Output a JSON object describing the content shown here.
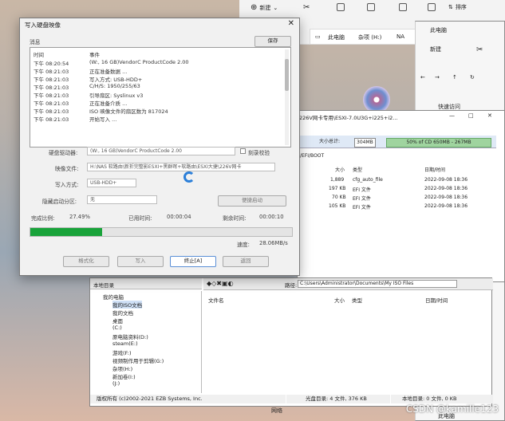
{
  "explorer": {
    "new_label": "新建",
    "sort_label": "排序",
    "path": [
      "此电脑",
      "杂项 (H:)",
      "NA"
    ],
    "second_window_title": "此电脑",
    "second_new_label": "新建",
    "quick_access_label": "快速访问"
  },
  "dialog": {
    "title": "写入硬盘映像",
    "close_glyph": "✕",
    "message_label": "消息",
    "save_button": "保存",
    "log_headers": {
      "time": "时间",
      "event": "事件"
    },
    "log_rows": [
      {
        "time": "下午 08:20:54",
        "event": "(W:, 16 GB)VendorC ProductCode      2.00"
      },
      {
        "time": "下午 08:21:03",
        "event": "正在准备数据 ..."
      },
      {
        "time": "下午 08:21:03",
        "event": "写入方式: USB-HDD+"
      },
      {
        "time": "下午 08:21:03",
        "event": "C/H/S: 1950/255/63"
      },
      {
        "time": "下午 08:21:03",
        "event": "引导扇区: Syslinux v3"
      },
      {
        "time": "下午 08:21:03",
        "event": "正在准备介质 ..."
      },
      {
        "time": "下午 08:21:03",
        "event": "ISO 映像文件的扇区数为 817024"
      },
      {
        "time": "下午 08:21:03",
        "event": "开始写入 ..."
      }
    ],
    "drive_label": "硬盘驱动器:",
    "drive_value": "(W:, 16 GB)VendorC ProductCode      2.00",
    "verify_label": "刻录校验",
    "image_file_label": "映像文件:",
    "image_file_value": "H:\\NAS 软路由\\新折完整影ESXI+黑群晖+软路由\\ESXI大捷\\226V网卡",
    "write_method_label": "写入方式:",
    "write_method_value": "USB-HDD+",
    "hidden_partition_label": "隐藏启动分区:",
    "hidden_partition_value": "无",
    "convenient_boot_label": "便捷启动",
    "done_label": "完成比例:",
    "done_value": "27.49%",
    "elapsed_label": "已用时间:",
    "elapsed_value": "00:00:04",
    "remaining_label": "剩余时间:",
    "remaining_value": "00:00:10",
    "progress_fraction": 0.2749,
    "speed_label": "速度:",
    "speed_value": "28.06MB/s",
    "buttons": {
      "format": "格式化",
      "write": "写入",
      "stop": "终止[A]",
      "back": "返回"
    }
  },
  "ultraiso": {
    "title": "226V网卡专用\\ESXI-7.0U3G+i225+i2...",
    "size_label": "大小总计:",
    "size_value": "304MB",
    "capacity_value": "50% of CD 650MB - 267MB",
    "path": "/EFI/BOOT",
    "columns": {
      "size": "大小",
      "type": "类型",
      "date": "日期/时间"
    },
    "rows": [
      {
        "name": "cfg_auto_file",
        "size": "1,889",
        "type": "cfg_auto_file",
        "date": "2022-09-08 18:36"
      },
      {
        "name": "",
        "size": "197 KB",
        "type": "EFI 文件",
        "date": "2022-09-08 18:36"
      },
      {
        "name": "",
        "size": "70 KB",
        "type": "EFI 文件",
        "date": "2022-09-08 18:36"
      },
      {
        "name": "",
        "size": "105 KB",
        "type": "EFI 文件",
        "date": "2022-09-08 18:36"
      }
    ],
    "local_dir_label": "本地目录",
    "local_path_label": "路径:",
    "local_path_value": "C:\\Users\\Administrator\\Documents\\My ISO Files",
    "local_columns": {
      "name": "文件名",
      "size": "大小",
      "type": "类型",
      "date": "日期/时间"
    },
    "tree": [
      "我的电脑",
      "我的ISO文档",
      "我的文档",
      "桌面",
      "(C:)",
      "原电脑资料(D:)",
      "steam(E:)",
      "游戏(F:)",
      "视频制作用于剪辑(G:)",
      "杂项(H:)",
      "新加卷(I:)",
      "(J:)"
    ],
    "copyright": "版权所有 (c)2002-2021 EZB Systems, Inc.",
    "disc_status": "光盘目录: 4 文件, 376 KB",
    "local_status": "本地目录: 0 文件, 0 KB"
  },
  "taskbar_hint": {
    "network_label": "网络",
    "this_pc_label": "此电脑"
  },
  "watermark": "CSDN @kamille123"
}
